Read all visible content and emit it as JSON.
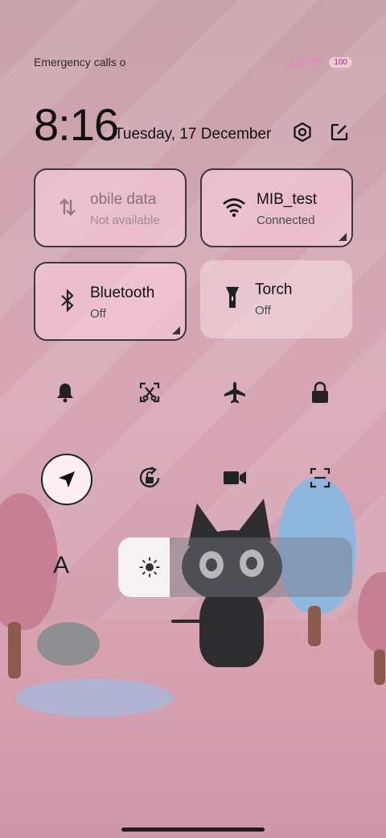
{
  "status_bar": {
    "carrier_text": "Emergency calls o",
    "battery": "100"
  },
  "header": {
    "time": "8:16",
    "date": "Tuesday, 17 December"
  },
  "tiles": {
    "mobile_data": {
      "title": "obile data",
      "subtitle": "Not available"
    },
    "wifi": {
      "title": "MIB_test",
      "subtitle": "Connected"
    },
    "bluetooth": {
      "title": "Bluetooth",
      "subtitle": "Off"
    },
    "torch": {
      "title": "Torch",
      "subtitle": "Off"
    }
  },
  "font_label": "A",
  "brightness": {
    "level": 0.22
  },
  "icons": {
    "row1": [
      "bell-icon",
      "screenshot-icon",
      "airplane-icon",
      "lock-icon"
    ],
    "row2": [
      "location-icon",
      "rotation-lock-icon",
      "video-record-icon",
      "scan-icon"
    ]
  },
  "colors": {
    "accent": "#e0a0b5",
    "tile_border": "#3a3a3a"
  }
}
